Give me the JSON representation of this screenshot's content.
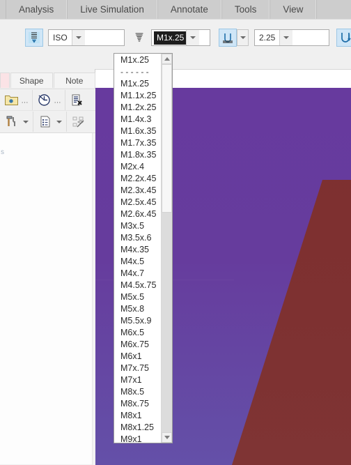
{
  "menubar": {
    "items": [
      {
        "label": "Analysis"
      },
      {
        "label": "Live Simulation"
      },
      {
        "label": "Annotate"
      },
      {
        "label": "Tools"
      },
      {
        "label": "View"
      }
    ]
  },
  "ribbon": {
    "thread_standard_icon": "thread-tap-icon",
    "standard_combo": {
      "value": "ISO"
    },
    "thread_size_icon": "screw-thread-icon",
    "size_combo": {
      "value": "M1x.25"
    },
    "end_condition_icon": "thread-end-condition-icon",
    "depth_combo": {
      "value": "2.25"
    },
    "thread_type_icon": "thread-class-icon",
    "extra_icons": [
      {
        "name": "chamfer-both-ends-icon"
      },
      {
        "name": "counterbore-icon"
      }
    ]
  },
  "left_panel": {
    "tabs": [
      {
        "label": "Shape"
      },
      {
        "label": "Note"
      }
    ],
    "toolbar_row1": [
      {
        "name": "feature-folder-icon"
      },
      {
        "name": "overflow-dots"
      },
      {
        "name": "history-clock-icon"
      },
      {
        "name": "overflow-dots"
      },
      {
        "name": "document-properties-icon"
      }
    ],
    "toolbar_row2": [
      {
        "name": "tools-hammer-icon"
      },
      {
        "name": "chevron-down-icon"
      },
      {
        "name": "list-properties-icon"
      },
      {
        "name": "chevron-down-icon"
      },
      {
        "name": "hide-structure-icon"
      }
    ],
    "tree_text": "s"
  },
  "dropdown": {
    "selected": "M1x.25",
    "items": [
      "M1x.25",
      "- - - - - -",
      "M1x.25",
      "M1.1x.25",
      "M1.2x.25",
      "M1.4x.3",
      "M1.6x.35",
      "M1.7x.35",
      "M1.8x.35",
      "M2x.4",
      "M2.2x.45",
      "M2.3x.45",
      "M2.5x.45",
      "M2.6x.45",
      "M3x.5",
      "M3.5x.6",
      "M4x.35",
      "M4x.5",
      "M4x.7",
      "M4.5x.75",
      "M5x.5",
      "M5x.8",
      "M5.5x.9",
      "M6x.5",
      "M6x.75",
      "M6x1",
      "M7x.75",
      "M7x1",
      "M8x.5",
      "M8x.75",
      "M8x1",
      "M8x1.25",
      "M9x1"
    ],
    "scrollbar": {
      "up_arrow": "scroll-up-icon",
      "down_arrow": "scroll-down-icon"
    }
  },
  "viewport": {
    "purple_color": "#663c9d",
    "red_color": "#7e3131"
  }
}
